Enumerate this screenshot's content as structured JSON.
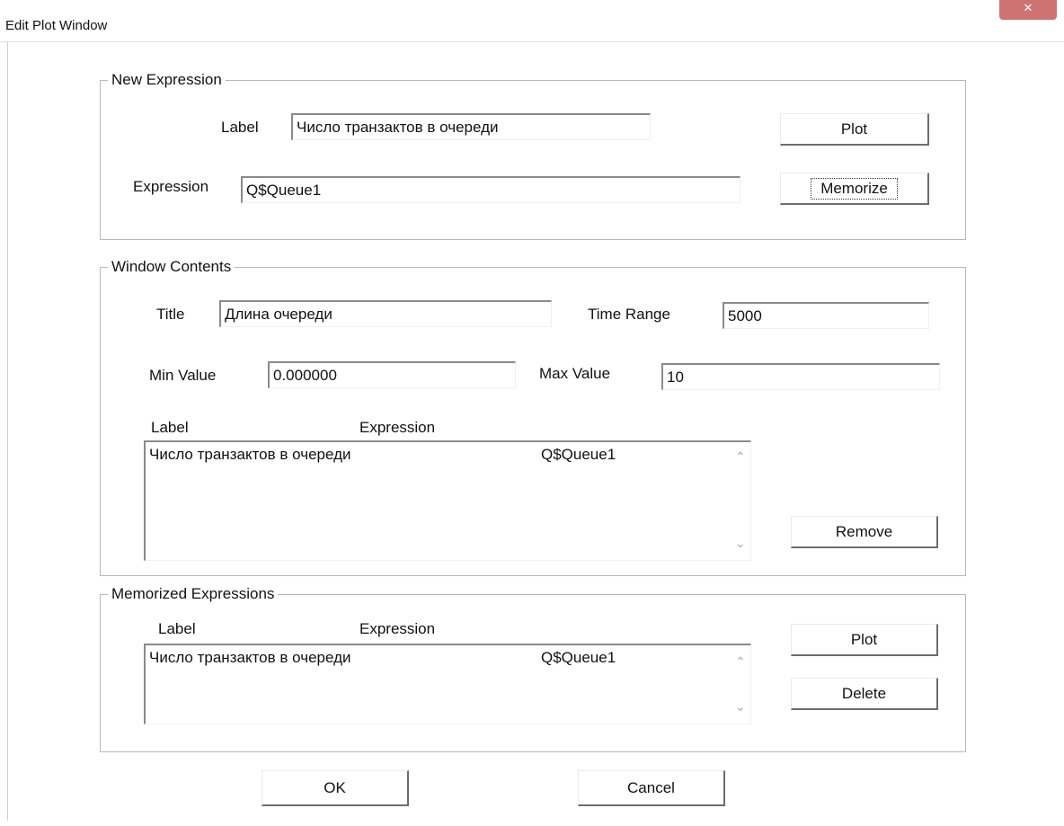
{
  "window": {
    "title": "Edit Plot Window",
    "close_glyph": "✕"
  },
  "new_expression": {
    "legend": "New Expression",
    "label_caption": "Label",
    "label_value": "Число транзактов в очереди",
    "expression_caption": "Expression",
    "expression_value": "Q$Queue1",
    "plot_button": "Plot",
    "memorize_button": "Memorize"
  },
  "window_contents": {
    "legend": "Window Contents",
    "title_caption": "Title",
    "title_value": "Длина очереди",
    "time_range_caption": "Time Range",
    "time_range_value": "5000",
    "min_value_caption": "Min Value",
    "min_value": "0.000000",
    "max_value_caption": "Max Value",
    "max_value": "10",
    "list_headers": [
      "Label",
      "Expression"
    ],
    "list_rows": [
      {
        "label": "Число транзактов в очереди",
        "expression": "Q$Queue1"
      }
    ],
    "remove_button": "Remove"
  },
  "memorized_expressions": {
    "legend": "Memorized Expressions",
    "list_headers": [
      "Label",
      "Expression"
    ],
    "list_rows": [
      {
        "label": "Число транзактов в очереди",
        "expression": "Q$Queue1"
      }
    ],
    "plot_button": "Plot",
    "delete_button": "Delete"
  },
  "footer": {
    "ok_button": "OK",
    "cancel_button": "Cancel"
  }
}
